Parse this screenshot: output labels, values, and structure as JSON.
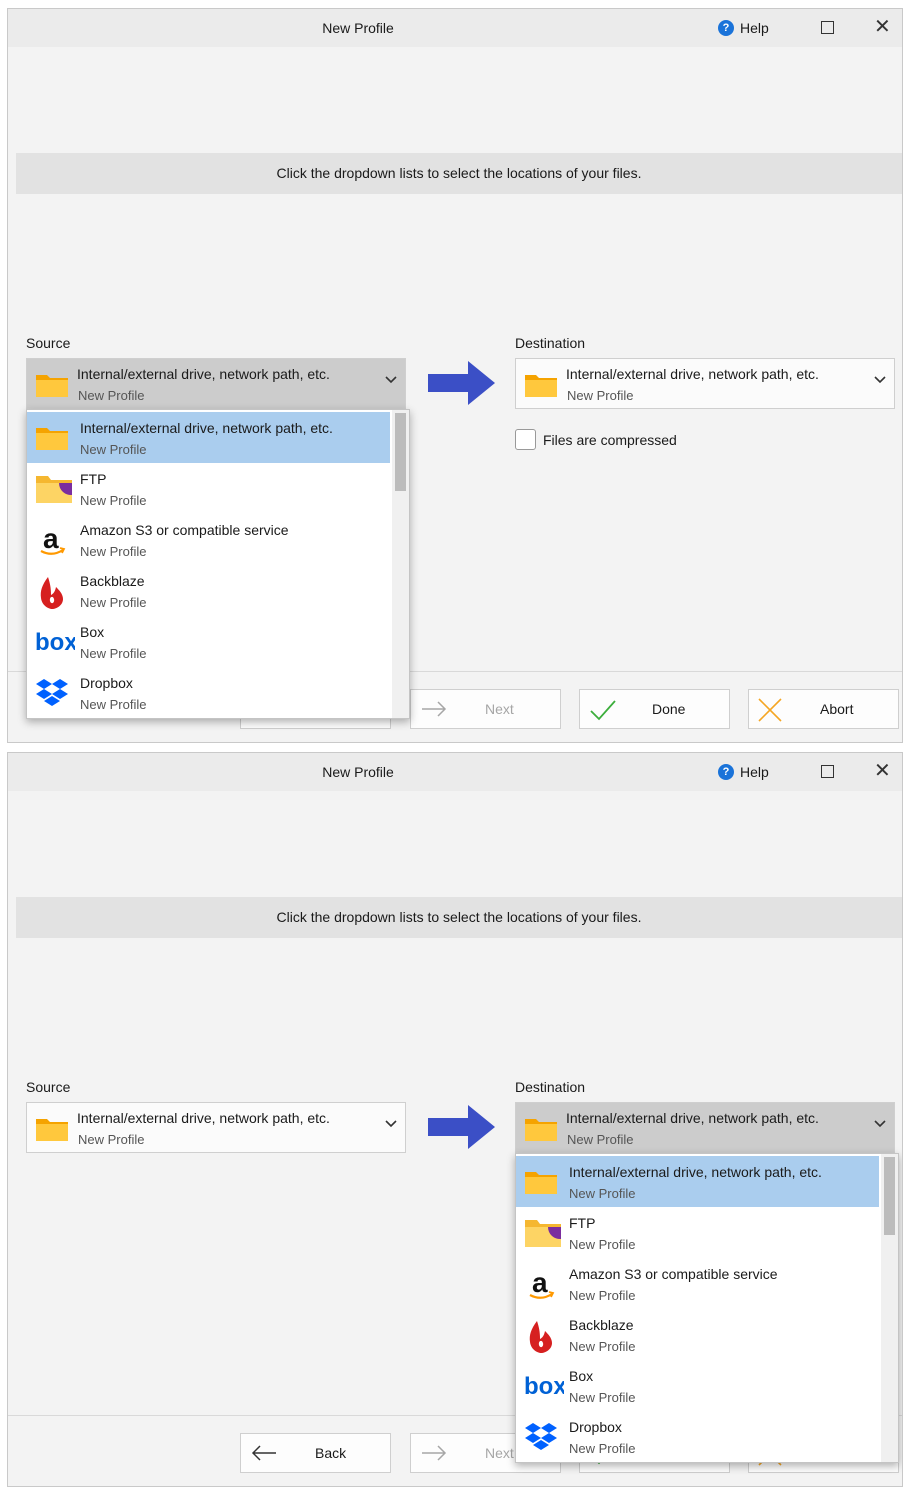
{
  "window": {
    "title": "New Profile",
    "help_label": "Help"
  },
  "banner_text": "Click the dropdown lists to select the locations of your files.",
  "source": {
    "label": "Source",
    "selected_title": "Internal/external drive, network path, etc.",
    "selected_subtitle": "New Profile"
  },
  "destination": {
    "label": "Destination",
    "selected_title": "Internal/external drive, network path, etc.",
    "selected_subtitle": "New Profile"
  },
  "compressed_label": "Files are compressed",
  "buttons": {
    "back": "Back",
    "next": "Next",
    "done": "Done",
    "abort": "Abort"
  },
  "dropdown_items": [
    {
      "title": "Internal/external drive, network path, etc.",
      "subtitle": "New Profile",
      "icon": "folder-icon"
    },
    {
      "title": "FTP",
      "subtitle": "New Profile",
      "icon": "ftp-icon"
    },
    {
      "title": "Amazon S3 or compatible service",
      "subtitle": "New Profile",
      "icon": "amazon-icon"
    },
    {
      "title": "Backblaze",
      "subtitle": "New Profile",
      "icon": "backblaze-icon"
    },
    {
      "title": "Box",
      "subtitle": "New Profile",
      "icon": "box-icon"
    },
    {
      "title": "Dropbox",
      "subtitle": "New Profile",
      "icon": "dropbox-icon"
    }
  ],
  "colors": {
    "accent_arrow": "#3b4fc6",
    "selection": "#aacdee",
    "folder": "#ffb51a",
    "done_check": "#3cae3c",
    "abort_x": "#f5a623"
  }
}
